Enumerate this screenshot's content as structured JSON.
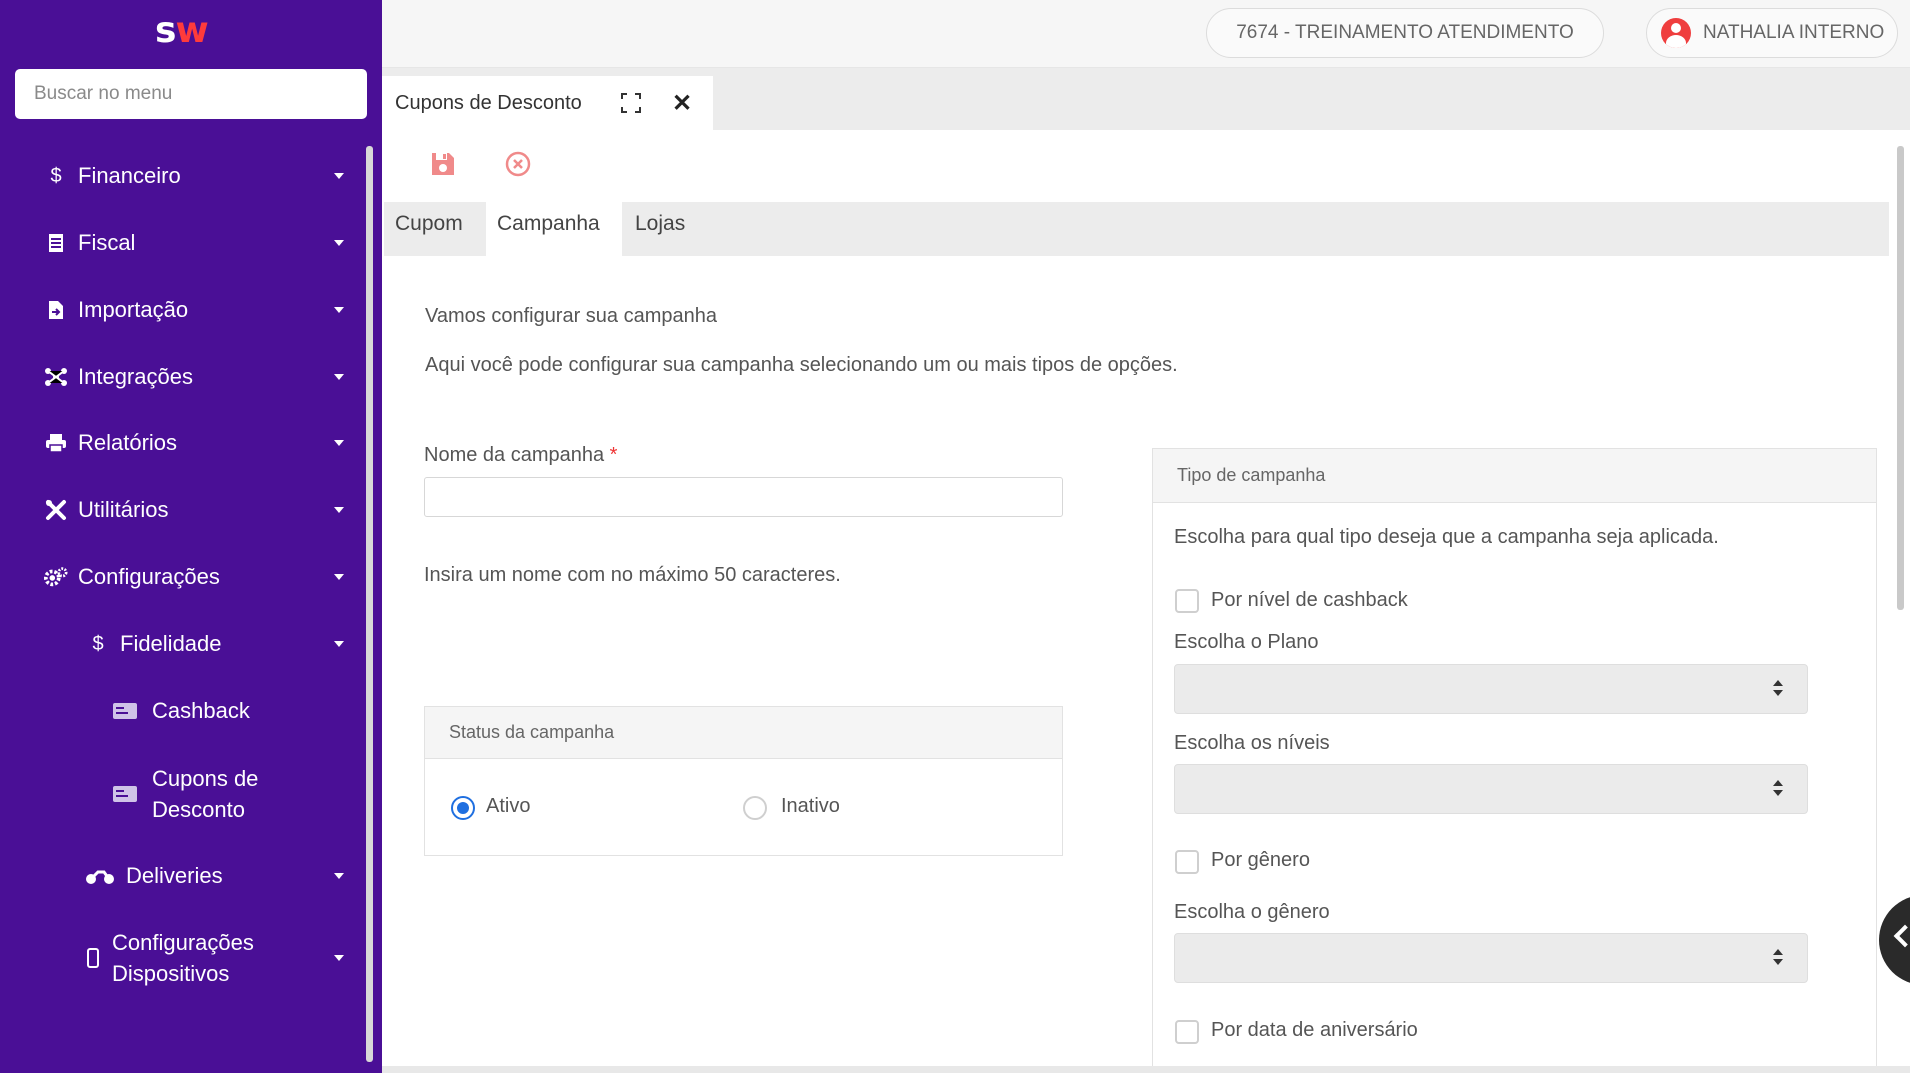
{
  "sidebar": {
    "logo": {
      "s": "s",
      "w": "w"
    },
    "search_placeholder": "Buscar no menu",
    "items": [
      {
        "label": "Financeiro",
        "icon": "dollar-icon"
      },
      {
        "label": "Fiscal",
        "icon": "document-icon"
      },
      {
        "label": "Importação",
        "icon": "file-import-icon"
      },
      {
        "label": "Integrações",
        "icon": "network-icon"
      },
      {
        "label": "Relatórios",
        "icon": "printer-icon"
      },
      {
        "label": "Utilitários",
        "icon": "tools-icon"
      },
      {
        "label": "Configurações",
        "icon": "gears-icon"
      },
      {
        "label": "Fidelidade",
        "icon": "dollar-icon"
      },
      {
        "label": "Cashback",
        "icon": "card-icon"
      },
      {
        "label_line1": "Cupons de",
        "label_line2": "Desconto",
        "icon": "card-icon"
      },
      {
        "label": "Deliveries",
        "icon": "motorcycle-icon"
      },
      {
        "label_line1": "Configurações",
        "label_line2": "Dispositivos",
        "icon": "mobile-icon"
      }
    ]
  },
  "topbar": {
    "company": "7674 - TREINAMENTO ATENDIMENTO",
    "user": "NATHALIA INTERNO"
  },
  "window_tab": {
    "title": "Cupons de Desconto"
  },
  "inner_tabs": [
    "Cupom",
    "Campanha",
    "Lojas"
  ],
  "active_tab": "Campanha",
  "main": {
    "heading": "Vamos configurar sua campanha",
    "subheading": "Aqui você pode configurar sua campanha selecionando um ou mais tipos de opções.",
    "name_label": "Nome da campanha",
    "required_mark": "*",
    "name_value": "",
    "name_hint": "Insira um nome com no máximo 50 caracteres.",
    "status": {
      "title": "Status da campanha",
      "options": [
        "Ativo",
        "Inativo"
      ],
      "selected": "Ativo"
    },
    "type": {
      "title": "Tipo de campanha",
      "description": "Escolha para qual tipo deseja que a campanha seja aplicada.",
      "cashback_checkbox": "Por nível de cashback",
      "plan_label": "Escolha o Plano",
      "levels_label": "Escolha os níveis",
      "gender_checkbox": "Por gênero",
      "gender_label": "Escolha o gênero",
      "birthday_checkbox": "Por data de aniversário"
    }
  },
  "colors": {
    "sidebar_bg": "#4a0f96",
    "accent_red": "#ef3e3e",
    "radio_blue": "#1f6fe0"
  }
}
